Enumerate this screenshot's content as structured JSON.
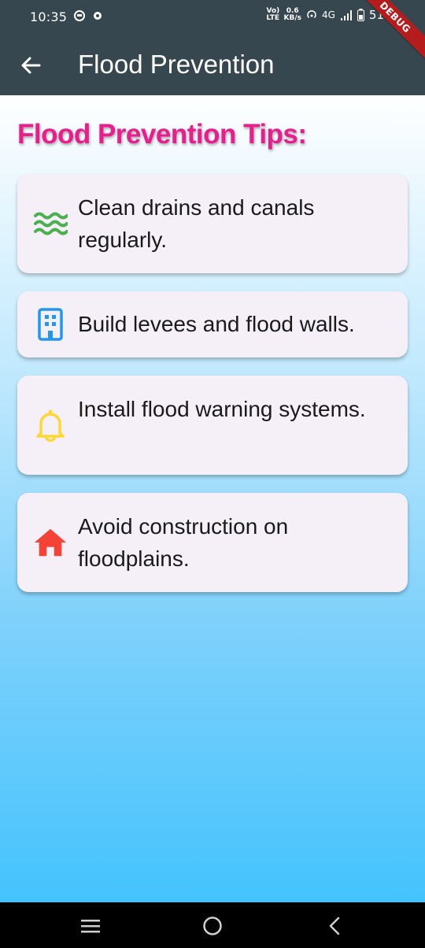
{
  "status_bar": {
    "time": "10:35",
    "network_top": "Vo) LTE",
    "speed_value": "0.6",
    "speed_unit": "KB/s",
    "network_type": "4G",
    "battery": "51"
  },
  "debug_banner": "DEBUG",
  "app_bar": {
    "title": "Flood Prevention",
    "back_icon": "arrow-back-icon"
  },
  "heading": "Flood Prevention Tips:",
  "tips": [
    {
      "icon": "waves-icon",
      "icon_color": "#4caf50",
      "text": "Clean drains and canals regularly."
    },
    {
      "icon": "building-icon",
      "icon_color": "#2196f3",
      "text": "Build levees and flood walls."
    },
    {
      "icon": "bell-icon",
      "icon_color": "#ffeb3b",
      "text": "Install flood warning systems."
    },
    {
      "icon": "home-icon",
      "icon_color": "#f44336",
      "text": "Avoid construction on floodplains."
    }
  ],
  "colors": {
    "app_bar": "#37474f",
    "heading": "#e91e8c",
    "card": "#f5eff7",
    "gradient_bottom": "#44c3fd"
  },
  "nav_bar": {
    "recent_icon": "recent-apps-icon",
    "home_icon": "home-circle-icon",
    "back_icon": "nav-back-icon"
  }
}
